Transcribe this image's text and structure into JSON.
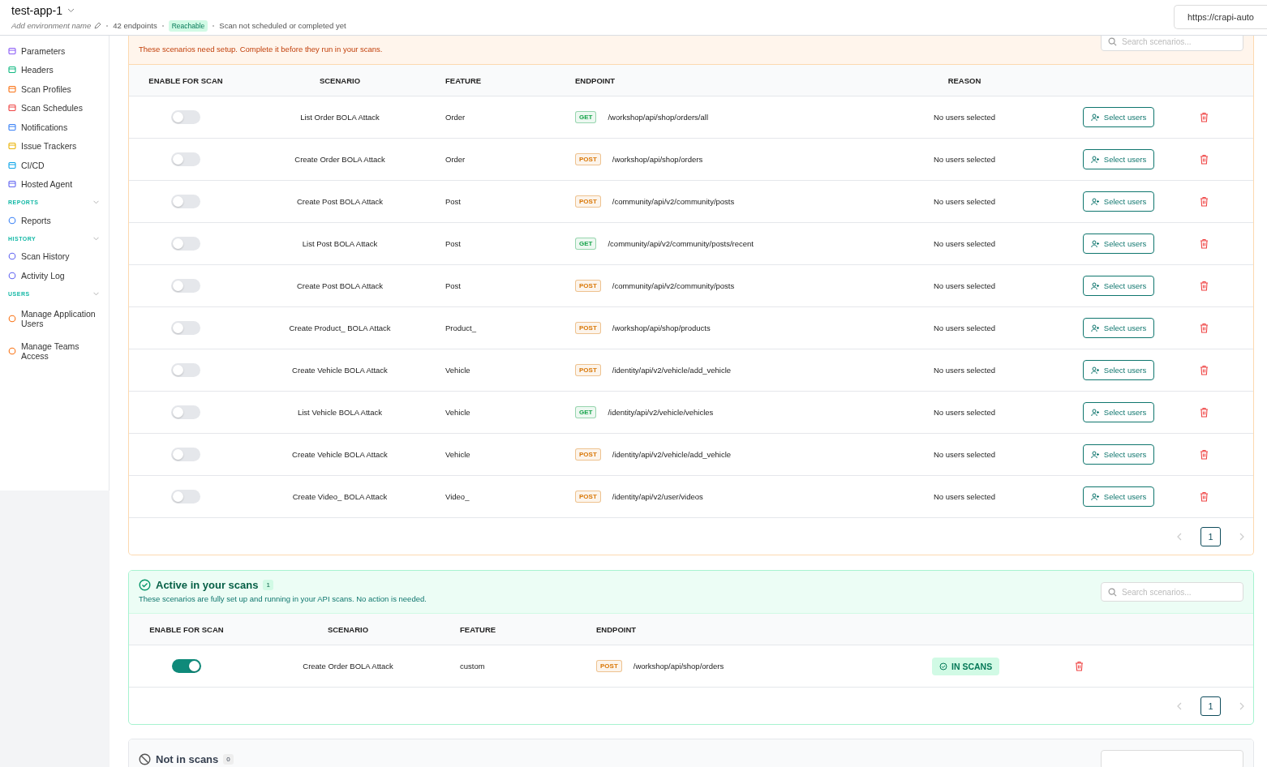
{
  "header": {
    "title": "test-app-1",
    "environment_placeholder": "Add environment name",
    "endpoints": "42 endpoints",
    "status_badge": "Reachable",
    "scan_status": "Scan not scheduled or completed yet",
    "url": "https://crapi-auto"
  },
  "sidebar": {
    "items": [
      {
        "label": "Parameters"
      },
      {
        "label": "Headers"
      },
      {
        "label": "Scan Profiles"
      },
      {
        "label": "Scan Schedules"
      },
      {
        "label": "Notifications"
      },
      {
        "label": "Issue Trackers"
      },
      {
        "label": "CI/CD"
      },
      {
        "label": "Hosted Agent"
      }
    ],
    "sections": [
      {
        "title": "REPORTS",
        "expanded": true,
        "items": [
          {
            "label": "Reports"
          }
        ]
      },
      {
        "title": "HISTORY",
        "expanded": true,
        "items": [
          {
            "label": "Scan History"
          },
          {
            "label": "Activity Log"
          }
        ]
      },
      {
        "title": "USERS",
        "expanded": true,
        "items": [
          {
            "label": "Manage Application Users"
          },
          {
            "label": "Manage Teams Access"
          }
        ]
      }
    ]
  },
  "attention": {
    "subtitle": "These scenarios need setup. Complete it before they run in your scans.",
    "search_placeholder": "Search scenarios...",
    "columns": [
      "ENABLE FOR SCAN",
      "SCENARIO",
      "FEATURE",
      "ENDPOINT",
      "REASON"
    ],
    "rows": [
      {
        "on": false,
        "scenario": "List Order BOLA Attack",
        "feature": "Order",
        "method": "GET",
        "color": "#16a34a",
        "endpoint": "/workshop/api/shop/orders/all",
        "reason": "No users selected",
        "action": "Select users"
      },
      {
        "on": false,
        "scenario": "Create Order BOLA Attack",
        "feature": "Order",
        "method": "POST",
        "color": "#d97706",
        "endpoint": "/workshop/api/shop/orders",
        "reason": "No users selected",
        "action": "Select users"
      },
      {
        "on": false,
        "scenario": "Create Post BOLA Attack",
        "feature": "Post",
        "method": "POST",
        "color": "#d97706",
        "endpoint": "/community/api/v2/community/posts",
        "reason": "No users selected",
        "action": "Select users"
      },
      {
        "on": false,
        "scenario": "List Post BOLA Attack",
        "feature": "Post",
        "method": "GET",
        "color": "#16a34a",
        "endpoint": "/community/api/v2/community/posts/recent",
        "reason": "No users selected",
        "action": "Select users"
      },
      {
        "on": false,
        "scenario": "Create Post BOLA Attack",
        "feature": "Post",
        "method": "POST",
        "color": "#d97706",
        "endpoint": "/community/api/v2/community/posts",
        "reason": "No users selected",
        "action": "Select users"
      },
      {
        "on": false,
        "scenario": "Create Product_ BOLA Attack",
        "feature": "Product_",
        "method": "POST",
        "color": "#d97706",
        "endpoint": "/workshop/api/shop/products",
        "reason": "No users selected",
        "action": "Select users"
      },
      {
        "on": false,
        "scenario": "Create Vehicle BOLA Attack",
        "feature": "Vehicle",
        "method": "POST",
        "color": "#d97706",
        "endpoint": "/identity/api/v2/vehicle/add_vehicle",
        "reason": "No users selected",
        "action": "Select users"
      },
      {
        "on": false,
        "scenario": "List Vehicle BOLA Attack",
        "feature": "Vehicle",
        "method": "GET",
        "color": "#16a34a",
        "endpoint": "/identity/api/v2/vehicle/vehicles",
        "reason": "No users selected",
        "action": "Select users"
      },
      {
        "on": false,
        "scenario": "Create Vehicle BOLA Attack",
        "feature": "Vehicle",
        "method": "POST",
        "color": "#d97706",
        "endpoint": "/identity/api/v2/vehicle/add_vehicle",
        "reason": "No users selected",
        "action": "Select users"
      },
      {
        "on": false,
        "scenario": "Create Video_ BOLA Attack",
        "feature": "Video_",
        "method": "POST",
        "color": "#d97706",
        "endpoint": "/identity/api/v2/user/videos",
        "reason": "No users selected",
        "action": "Select users"
      }
    ],
    "pages": [
      {
        "label": "1",
        "selected": true
      }
    ]
  },
  "active": {
    "title": "Active in your scans",
    "count": "1",
    "subtitle": "These scenarios are fully set up and running in your API scans. No action is needed.",
    "search_placeholder": "Search scenarios...",
    "columns": [
      "ENABLE FOR SCAN",
      "SCENARIO",
      "FEATURE",
      "ENDPOINT"
    ],
    "rows": [
      {
        "on": true,
        "scenario": "Create Order BOLA Attack",
        "feature": "custom",
        "method": "POST",
        "color": "#d97706",
        "endpoint": "/workshop/api/shop/orders",
        "status": "IN SCANS"
      }
    ],
    "pages": [
      {
        "label": "1",
        "selected": true
      }
    ]
  },
  "not_in_scans": {
    "title": "Not in scans",
    "count": "0"
  }
}
